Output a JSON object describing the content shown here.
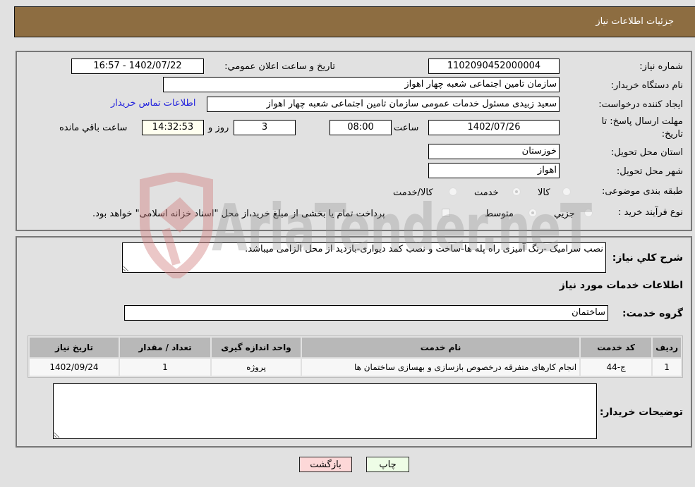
{
  "header": {
    "title": "جزئیات اطلاعات نیاز"
  },
  "details": {
    "need_number_label": "شماره نیاز:",
    "need_number": "1102090452000004",
    "announce_label": "تاریخ و ساعت اعلان عمومي:",
    "announce_value": "1402/07/22 - 16:57",
    "buyer_org_label": "نام دستگاه خریدار:",
    "buyer_org": "سازمان تامین اجتماعی شعبه چهار اهواز",
    "creator_label": "ایجاد کننده درخواست:",
    "creator": "سعید زبیدی مسئول خدمات عمومی سازمان تامین اجتماعی شعبه چهار اهواز",
    "buyer_contact_link": "اطلاعات تماس خریدار",
    "deadline_label": "مهلت ارسال پاسخ: تا تاریخ:",
    "deadline_date": "1402/07/26",
    "time_label": "ساعت",
    "deadline_time": "08:00",
    "days_value": "3",
    "days_label": "روز و",
    "remaining_time": "14:32:53",
    "remaining_label": "ساعت باقي مانده",
    "province_label": "استان محل تحویل:",
    "province": "خوزستان",
    "city_label": "شهر محل تحویل:",
    "city": "اهواز",
    "category_label": "طبقه بندی موضوعی:",
    "category_options": [
      {
        "label": "کالا",
        "checked": false
      },
      {
        "label": "خدمت",
        "checked": true
      },
      {
        "label": "کالا/خدمت",
        "checked": false
      }
    ],
    "purchase_type_label": "نوع فرآیند خرید :",
    "purchase_type_options": [
      {
        "label": "جزيي",
        "checked": false
      },
      {
        "label": "متوسط",
        "checked": true
      }
    ],
    "treasury_note": "پرداخت تمام یا بخشی از مبلغ خرید،از محل \"اسناد خزانه اسلامی\" خواهد بود.",
    "treasury_checked": false
  },
  "services": {
    "description_label": "شرح کلي نياز:",
    "description": "نصب سرامیک -رنگ آمیزی راه پله ها-ساخت و نصب کمد دیواری-بازدید از محل الزامی میباشد.",
    "section_title": "اطلاعات خدمات مورد نياز",
    "group_label": "گروه خدمت:",
    "group_value": "ساختمان",
    "table": {
      "headers": [
        "رديف",
        "کد خدمت",
        "نام خدمت",
        "واحد اندازه گیری",
        "تعداد / مقدار",
        "تاریخ نیاز"
      ],
      "rows": [
        [
          "1",
          "ج-44",
          "انجام کارهای متفرقه درخصوص بازسازی و بهسازی ساختمان ها",
          "پروژه",
          "1",
          "1402/09/24"
        ]
      ]
    },
    "buyer_notes_label": "توضیحات خریدار:",
    "buyer_notes": ""
  },
  "buttons": {
    "print": "چاپ",
    "back": "بازگشت"
  },
  "watermark": {
    "text": "AriaTender.neT",
    "logo_color": "#d9a0a0"
  }
}
